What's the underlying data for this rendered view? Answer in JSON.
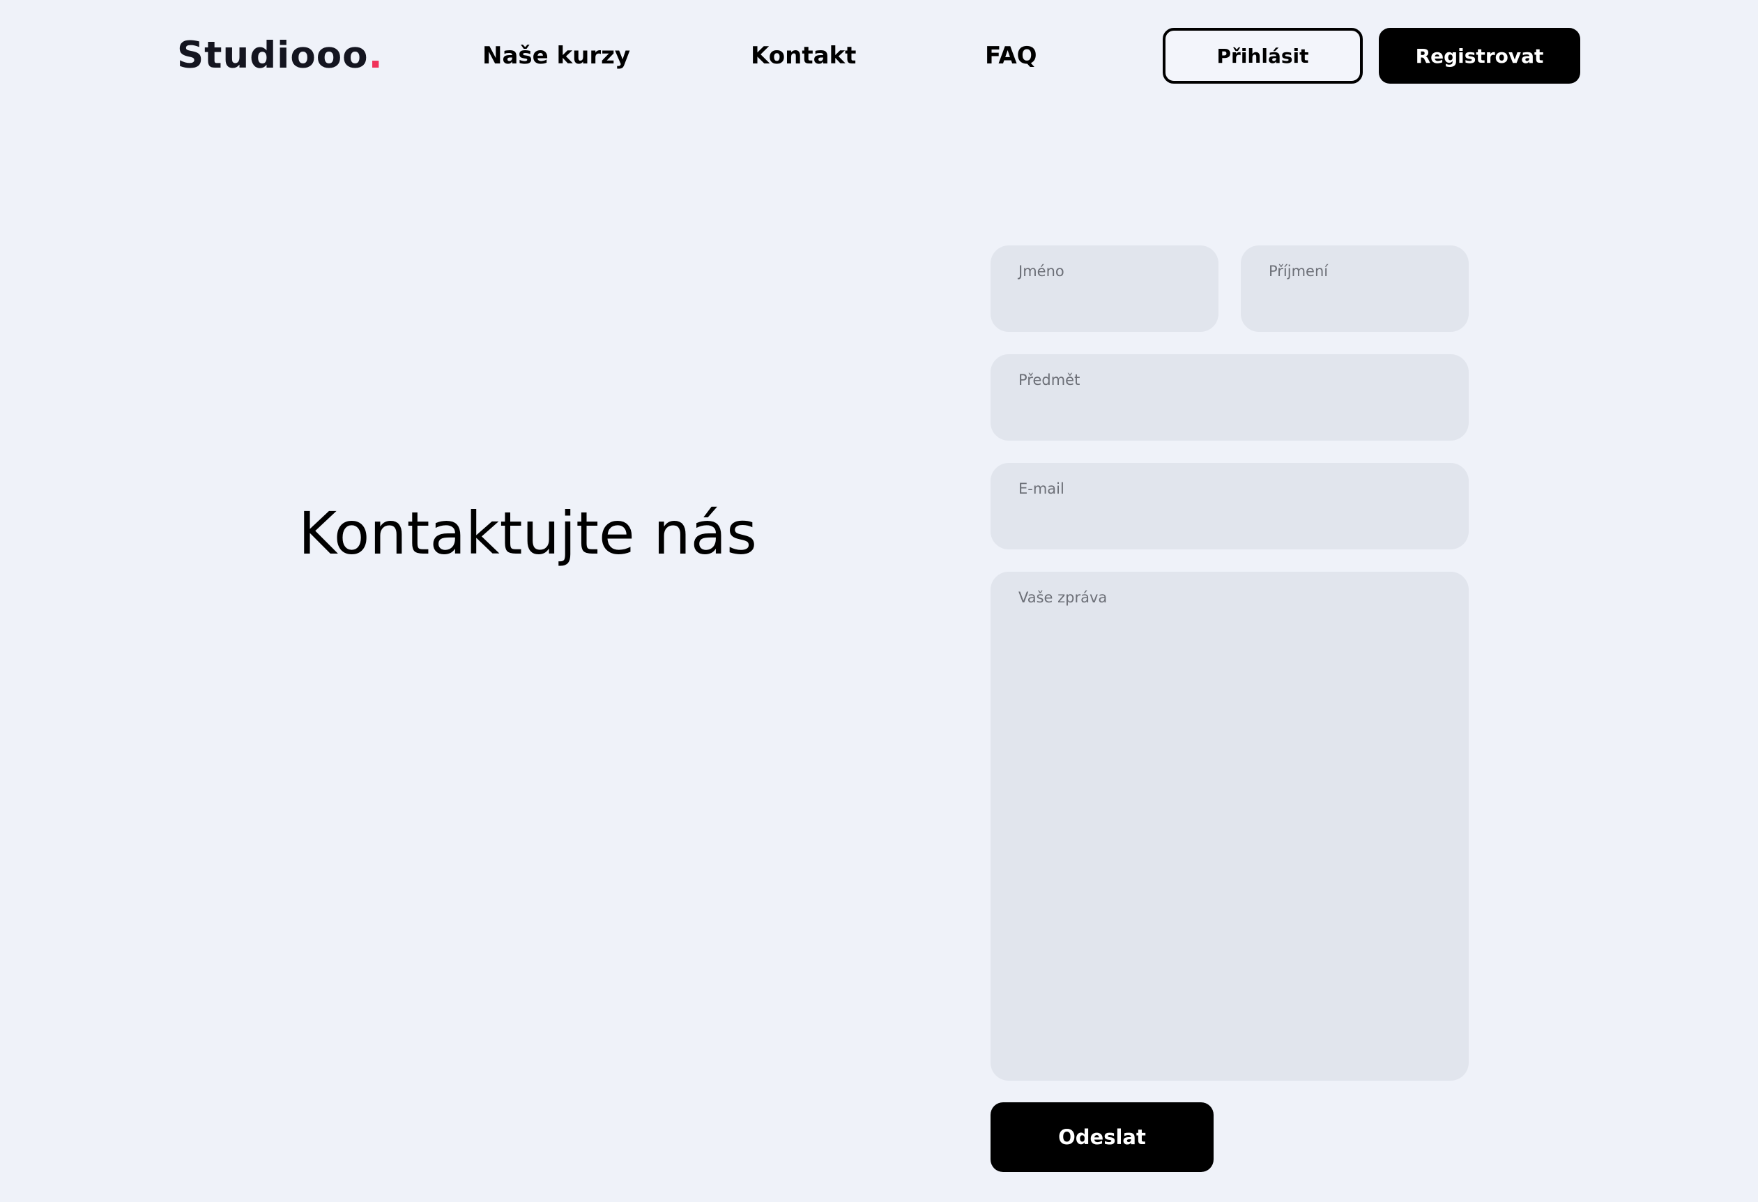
{
  "header": {
    "logo_text": "Studiooo",
    "logo_dot": ".",
    "nav": {
      "courses": "Naše kurzy",
      "contact": "Kontakt",
      "faq": "FAQ"
    },
    "login_label": "Přihlásit",
    "register_label": "Registrovat"
  },
  "main": {
    "heading": "Kontaktujte nás"
  },
  "form": {
    "first_name": {
      "label": "Jméno",
      "value": ""
    },
    "last_name": {
      "label": "Příjmení",
      "value": ""
    },
    "subject": {
      "label": "Předmět",
      "value": ""
    },
    "email": {
      "label": "E-mail",
      "value": ""
    },
    "message": {
      "label": "Vaše zpráva",
      "value": ""
    },
    "submit_label": "Odeslat"
  },
  "colors": {
    "background": "#eff2f9",
    "field_background": "#e1e5ed",
    "accent_dot": "#f0325a",
    "button": "#000000",
    "label_text": "#6c6f77"
  }
}
